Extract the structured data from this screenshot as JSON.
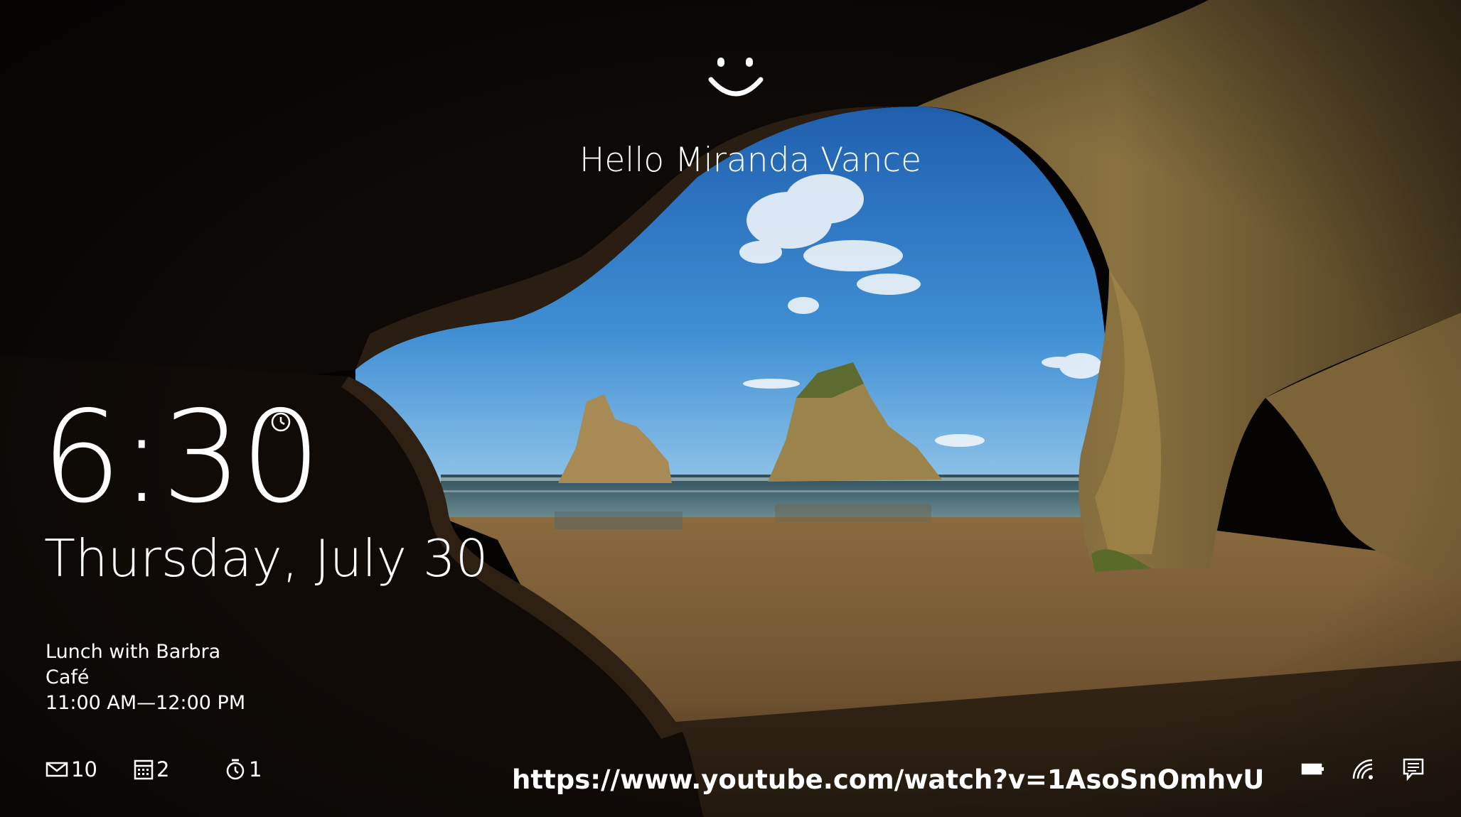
{
  "lockscreen": {
    "greeting": "Hello Miranda Vance",
    "time": "6:30",
    "date": "Thursday, July 30",
    "event": {
      "title": "Lunch with Barbra",
      "location": "Café",
      "time_range": "11:00 AM—12:00 PM"
    },
    "badges": [
      {
        "icon": "mail-icon",
        "count": "10"
      },
      {
        "icon": "calendar-icon",
        "count": "2"
      },
      {
        "icon": "alarm-icon",
        "count": "1"
      }
    ],
    "status_icons": [
      "battery-icon",
      "wifi-icon",
      "notification-icon"
    ]
  },
  "overlay_url": "https://www.youtube.com/watch?v=1AsoSnOmhvU"
}
